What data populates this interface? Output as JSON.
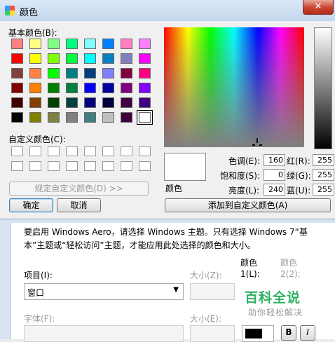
{
  "dialog": {
    "title": "颜色",
    "close_glyph": "✕",
    "basic_colors_label": "基本颜色(B):",
    "custom_colors_label": "自定义颜色(C):",
    "define_custom_button": "规定自定义颜色(D) >>",
    "ok_button": "确定",
    "cancel_button": "取消",
    "add_custom_button": "添加到自定义颜色(A)",
    "preview_label": "颜色",
    "basic_colors": [
      "#ff8080",
      "#ffff80",
      "#80ff80",
      "#00ff80",
      "#80ffff",
      "#0080ff",
      "#ff80c0",
      "#ff80ff",
      "#ff0000",
      "#ffff00",
      "#80ff00",
      "#00ff40",
      "#00ffff",
      "#0080c0",
      "#8080c0",
      "#ff00ff",
      "#804040",
      "#ff8040",
      "#00ff00",
      "#008080",
      "#004080",
      "#8080ff",
      "#800040",
      "#ff0080",
      "#800000",
      "#ff8000",
      "#008000",
      "#008040",
      "#0000ff",
      "#0000a0",
      "#800080",
      "#8000ff",
      "#400000",
      "#804000",
      "#004000",
      "#004040",
      "#000080",
      "#000040",
      "#400040",
      "#400080",
      "#000000",
      "#808000",
      "#808040",
      "#808080",
      "#408080",
      "#c0c0c0",
      "#400040",
      "#ffffff"
    ],
    "selected_color_index": 47,
    "hue_label": "色调(E):",
    "hue_value": "160",
    "sat_label": "饱和度(S):",
    "sat_value": "0",
    "lum_label": "亮度(L):",
    "lum_value": "240",
    "red_label": "红(R):",
    "red_value": "255",
    "green_label": "绿(G):",
    "green_value": "255",
    "blue_label": "蓝(U):",
    "blue_value": "255"
  },
  "background_window": {
    "info_line1": "要启用 Windows Aero，请选择 Windows 主题。只有选择 Windows 7“基",
    "info_line2": "本”主题或“轻松访问”主题，才能应用此处选择的颜色和大小。",
    "item_label": "项目(I):",
    "item_value": "窗口",
    "size_label": "大小(Z):",
    "color1_label": "颜色\n1(L):",
    "color2_label": "颜色\n2(2):",
    "font_label": "字体(F):",
    "size2_label": "大小(E):",
    "bold_button": "B",
    "italic_button": "I"
  },
  "watermark": {
    "text": "百科全说",
    "subtext": "助你轻松解决"
  }
}
